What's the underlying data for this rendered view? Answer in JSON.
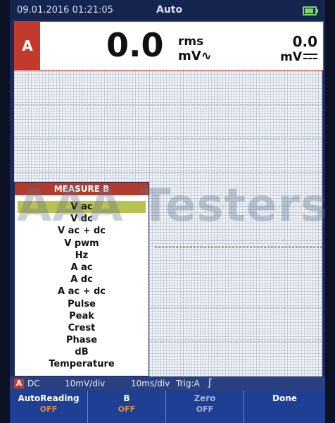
{
  "status": {
    "datetime": "09.01.2016 01:21:05",
    "mode": "Auto",
    "battery_level": 0.85
  },
  "reading": {
    "channel": "A",
    "value": "0.0",
    "qualifier": "rms",
    "unit": "mV",
    "ac_symbol": "∿",
    "secondary_value": "0.0",
    "secondary_unit": "mV"
  },
  "scope": {
    "marker": "A",
    "watermark": "AAA Testers"
  },
  "menu": {
    "title": "MEASURE B",
    "selected": "V ac",
    "items": [
      "V ac",
      "V dc",
      "V ac + dc",
      "V pwm",
      "Hz",
      "A ac",
      "A dc",
      "A ac + dc",
      "Pulse",
      "Peak",
      "Crest",
      "Phase",
      "dB",
      "Temperature"
    ]
  },
  "infobar": {
    "channel": "A",
    "coupling": "DC",
    "volts_div": "10mV/div",
    "time_div": "10ms/div",
    "trigger": "Trig:A",
    "trigger_icon": "ʃ"
  },
  "softkeys": [
    {
      "label": "AutoReading",
      "value": "OFF"
    },
    {
      "label": "B",
      "value": "OFF"
    },
    {
      "label": "Zero",
      "value": "OFF"
    },
    {
      "label": "Done",
      "value": ""
    }
  ],
  "colors": {
    "accent_red": "#c23a2b",
    "selection": "#b7c252",
    "softkey_value": "#e08a3a"
  }
}
